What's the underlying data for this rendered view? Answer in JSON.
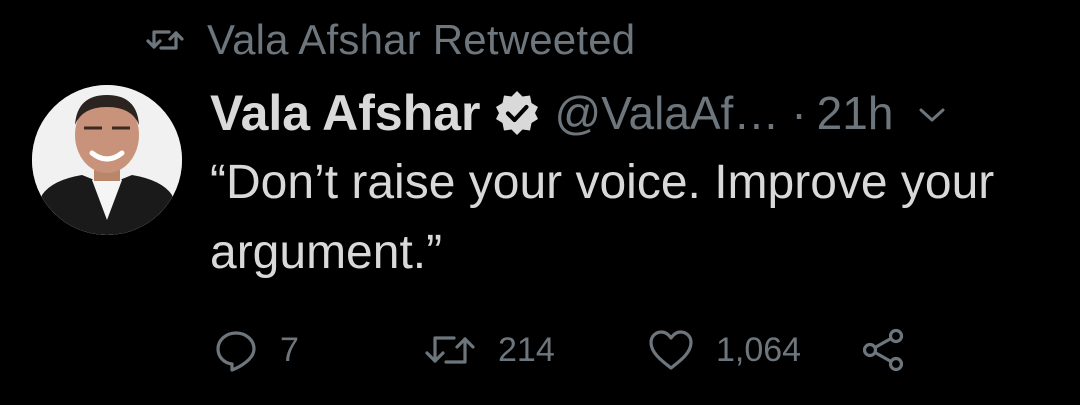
{
  "retweet_banner": {
    "text": "Vala Afshar Retweeted",
    "icon": "retweet-icon"
  },
  "tweet": {
    "author_name": "Vala Afshar",
    "verified": true,
    "handle": "@ValaAf…",
    "separator": "·",
    "timestamp": "21h",
    "text": "“Don’t raise your voice. Improve your argument.”"
  },
  "actions": {
    "reply_count": "7",
    "retweet_count": "214",
    "like_count": "1,064"
  },
  "colors": {
    "background": "#000000",
    "primary_text": "#d9d9d9",
    "secondary_text": "#6e767d"
  }
}
